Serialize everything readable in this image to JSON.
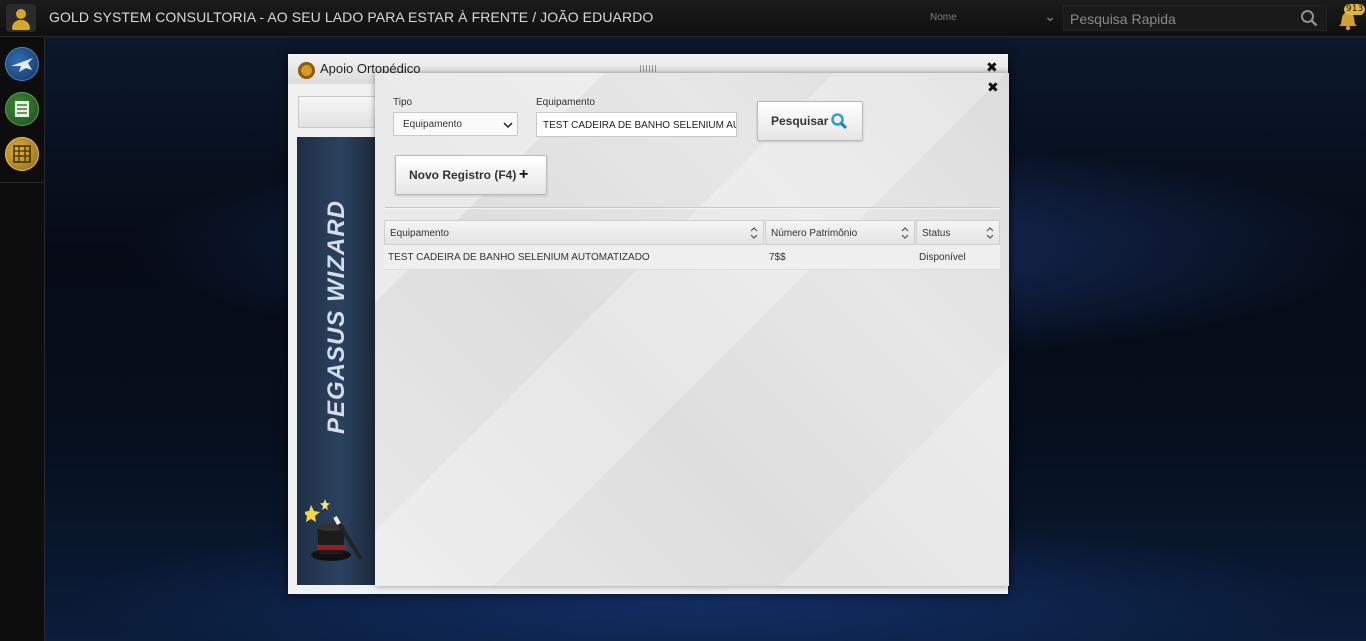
{
  "topbar": {
    "title": "GOLD SYSTEM CONSULTORIA - AO SEU LADO PARA ESTAR À FRENTE / JOÃO EDUARDO",
    "search_type": "Nome",
    "quick_search_placeholder": "Pesquisa Rapida",
    "notification_count": "913"
  },
  "outer_window": {
    "title": "Apoio Ortopédico",
    "wizard_label": "PEGASUS WIZARD"
  },
  "modal": {
    "tipo_label": "Tipo",
    "tipo_value": "Equipamento",
    "equipamento_label": "Equipamento",
    "equipamento_value": "TEST CADEIRA DE BANHO SELENIUM AU",
    "search_button": "Pesquisar",
    "new_button": "Novo Registro (F4)"
  },
  "table": {
    "columns": [
      "Equipamento",
      "Número Patrimônio",
      "Status"
    ],
    "rows": [
      [
        "TEST CADEIRA DE BANHO SELENIUM AUTOMATIZADO",
        "7$$",
        "Disponível"
      ]
    ]
  },
  "colors": {
    "accent_gold": "#d7a72c",
    "search_icon": "#2a9fd8"
  }
}
